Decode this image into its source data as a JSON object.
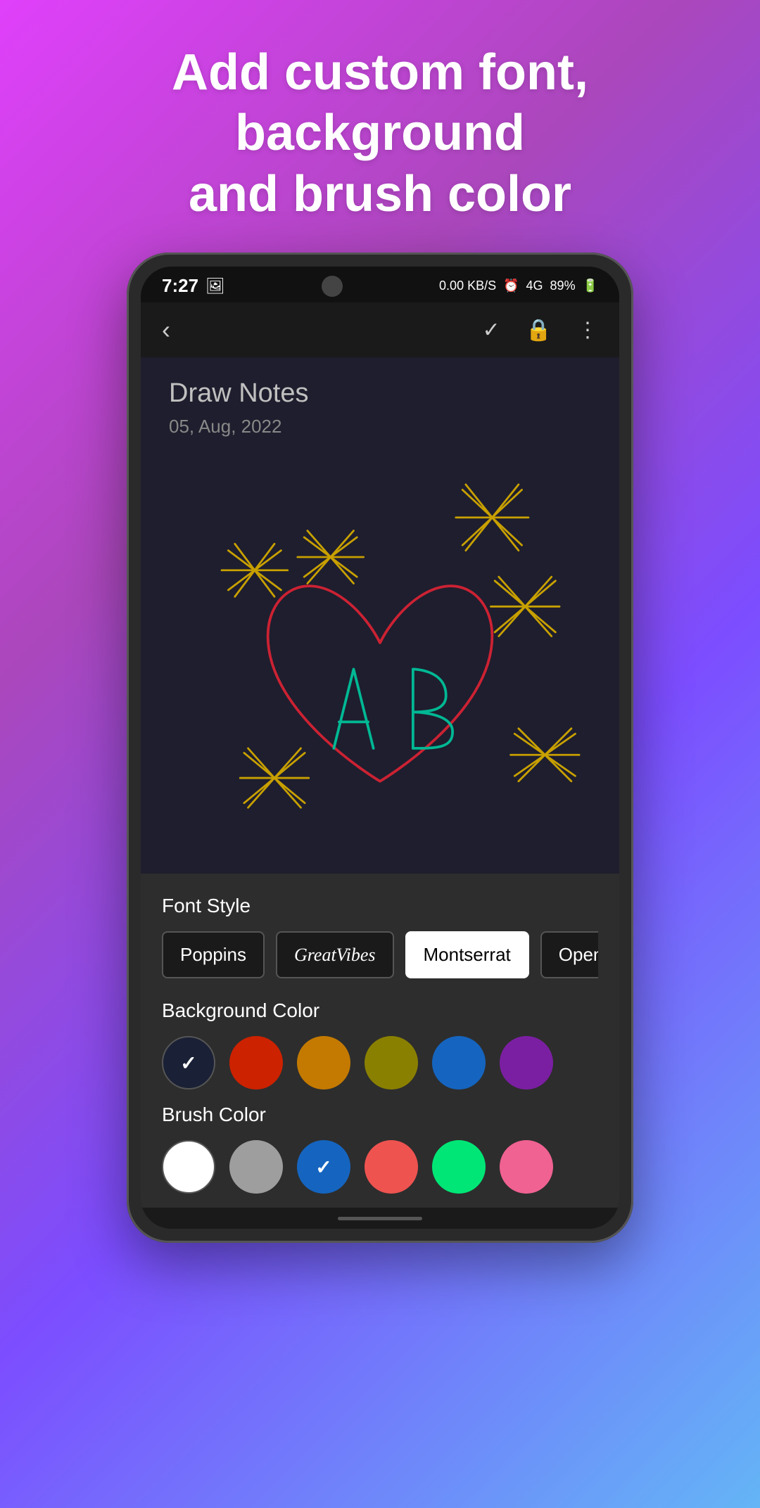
{
  "promo": {
    "title": "Add custom font, background\nand brush color"
  },
  "status_bar": {
    "time": "7:27",
    "battery": "89%",
    "signal": "4G"
  },
  "app_bar": {
    "back_icon": "‹",
    "check_icon": "✓",
    "lock_icon": "🔒",
    "more_icon": "⋮"
  },
  "note": {
    "title": "Draw Notes",
    "date": "05, Aug, 2022"
  },
  "bottom_panel": {
    "font_style_label": "Font Style",
    "fonts": [
      {
        "label": "Poppins",
        "active": false,
        "style": "normal"
      },
      {
        "label": "GreatVibes",
        "active": false,
        "style": "italic"
      },
      {
        "label": "Montserrat",
        "active": true,
        "style": "normal"
      },
      {
        "label": "Opensa",
        "active": false,
        "style": "normal"
      }
    ],
    "background_color_label": "Background Color",
    "background_colors": [
      {
        "color": "#1a2035",
        "selected": true
      },
      {
        "color": "#cc2200",
        "selected": false
      },
      {
        "color": "#c47a00",
        "selected": false
      },
      {
        "color": "#8a8000",
        "selected": false
      },
      {
        "color": "#1565c0",
        "selected": false
      },
      {
        "color": "#7b1fa2",
        "selected": false
      }
    ],
    "brush_color_label": "Brush Color",
    "brush_colors": [
      {
        "color": "#ffffff",
        "selected": false
      },
      {
        "color": "#9e9e9e",
        "selected": false
      },
      {
        "color": "#1565c0",
        "selected": true
      },
      {
        "color": "#ef5350",
        "selected": false
      },
      {
        "color": "#00e676",
        "selected": false
      },
      {
        "color": "#f06292",
        "selected": false
      }
    ]
  }
}
